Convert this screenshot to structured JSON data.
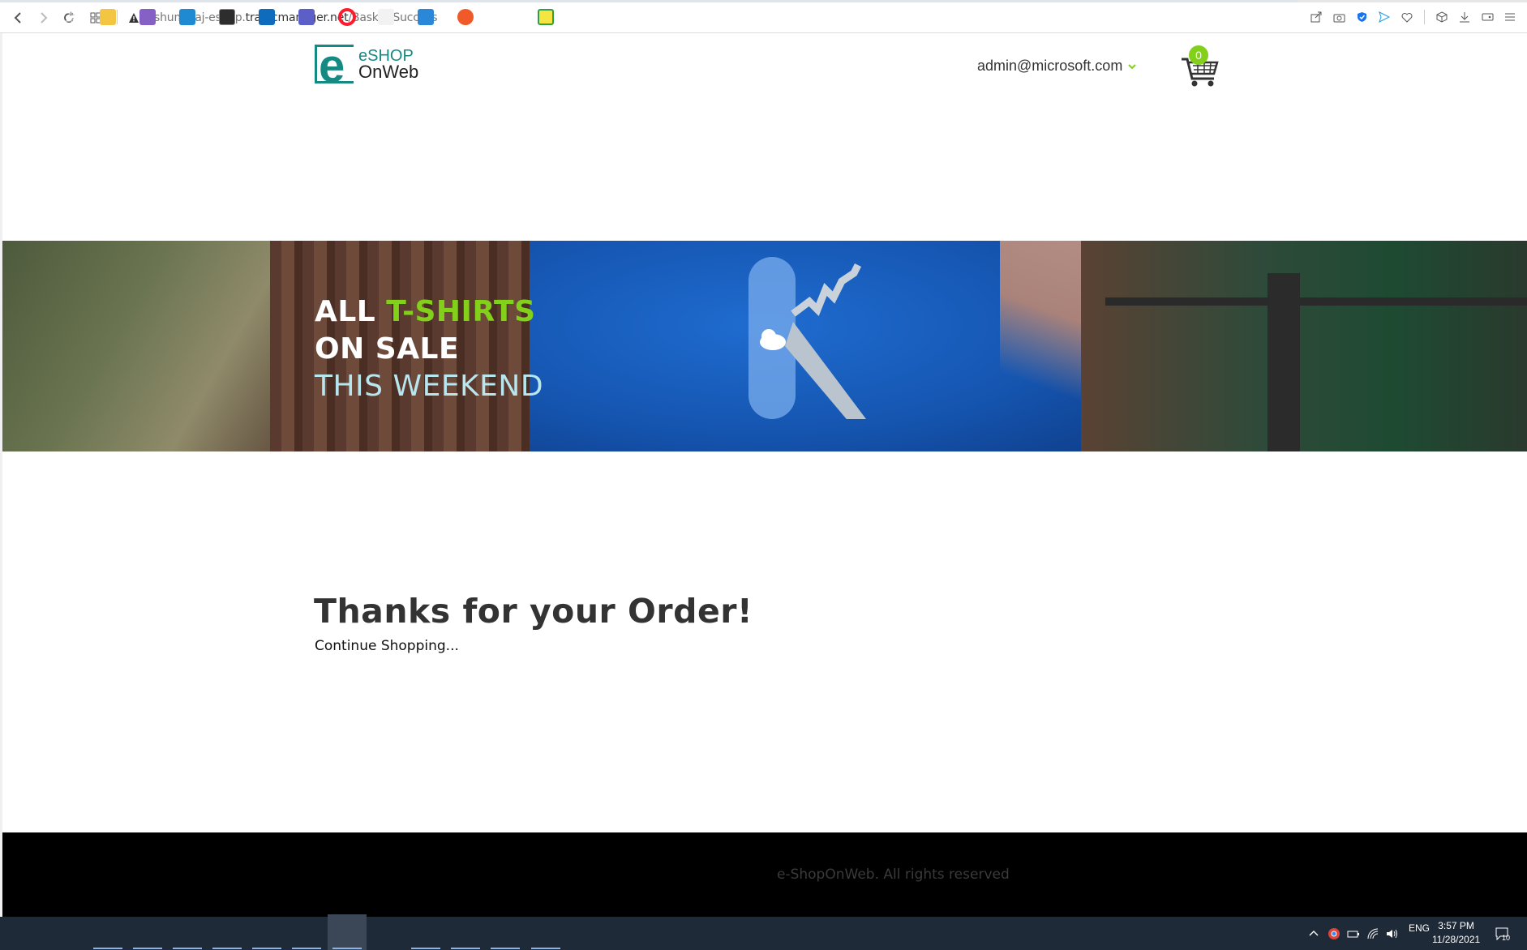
{
  "browser": {
    "url_prefix": "shumigaj-eshop.",
    "url_domain": "trafficmanager.net",
    "url_path": "/Basket/Success"
  },
  "header": {
    "logo_line1": "eSHOP",
    "logo_line2": "OnWeb",
    "logo_letter": "e",
    "user_email": "admin@microsoft.com",
    "cart_count": "0"
  },
  "hero": {
    "word_all": "ALL",
    "word_tshirts": "T-SHIRTS",
    "line_on_sale": "ON SALE",
    "line_weekend": "THIS WEEKEND"
  },
  "main": {
    "title": "Thanks for your Order!",
    "continue_link": "Continue Shopping..."
  },
  "footer": {
    "text": "e-ShopOnWeb. All rights reserved"
  },
  "taskbar": {
    "language": "ENG",
    "time": "3:57 PM",
    "date": "11/28/2021",
    "notifications": "10"
  },
  "colors": {
    "brand_teal": "#158a83",
    "accent_green": "#83d01b",
    "footer_bg": "#000000",
    "taskbar_bg": "#1f2a38"
  }
}
